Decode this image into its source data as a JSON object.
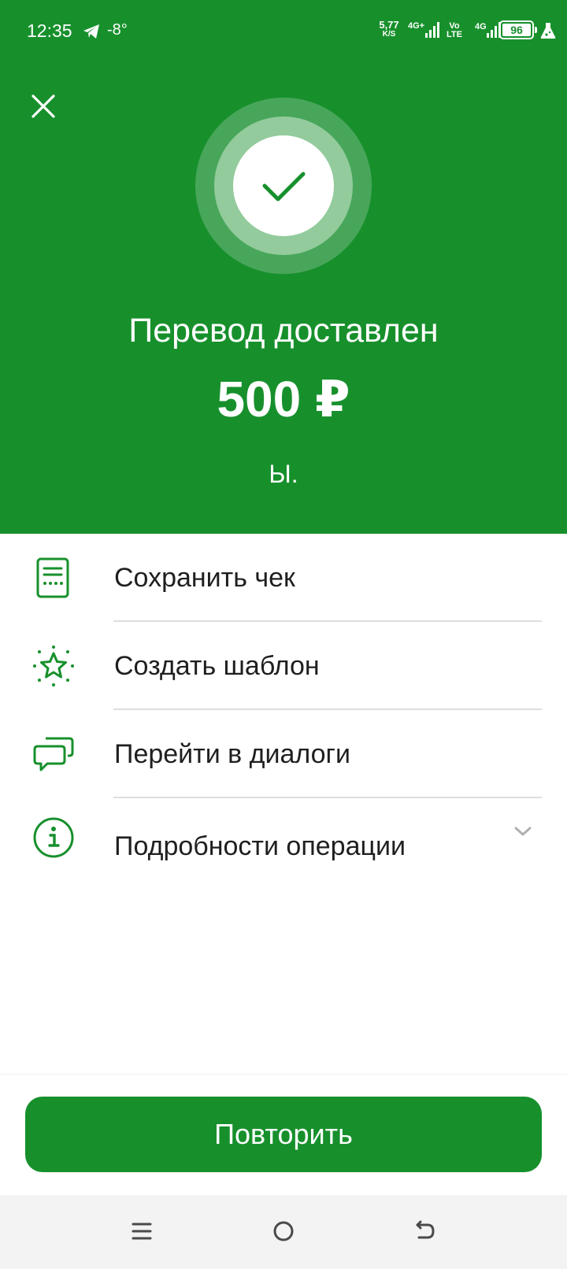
{
  "status_bar": {
    "time": "12:35",
    "temperature": "-8°",
    "net_speed_value": "5,77",
    "net_speed_unit": "K/S",
    "network_1": "4G+",
    "volte_top": "Vo",
    "volte_bottom": "LTE",
    "network_2": "4G",
    "battery": "96",
    "icons": [
      "telegram-icon",
      "signal-icon",
      "battery-icon",
      "flask-icon"
    ]
  },
  "result": {
    "title": "Перевод доставлен",
    "amount": "500 ₽",
    "recipient": "Ы."
  },
  "actions": [
    {
      "label": "Сохранить чек",
      "icon": "receipt-icon"
    },
    {
      "label": "Создать шаблон",
      "icon": "star-icon"
    },
    {
      "label": "Перейти в диалоги",
      "icon": "chat-icon"
    },
    {
      "label": "Подробности операции",
      "icon": "info-icon"
    }
  ],
  "footer": {
    "repeat_label": "Повторить"
  },
  "colors": {
    "brand_green": "#17902c",
    "ring_outer": "#48a65a",
    "ring_mid": "#93cb9c",
    "text_dark": "#1f1f1f",
    "divider": "#dedede"
  }
}
